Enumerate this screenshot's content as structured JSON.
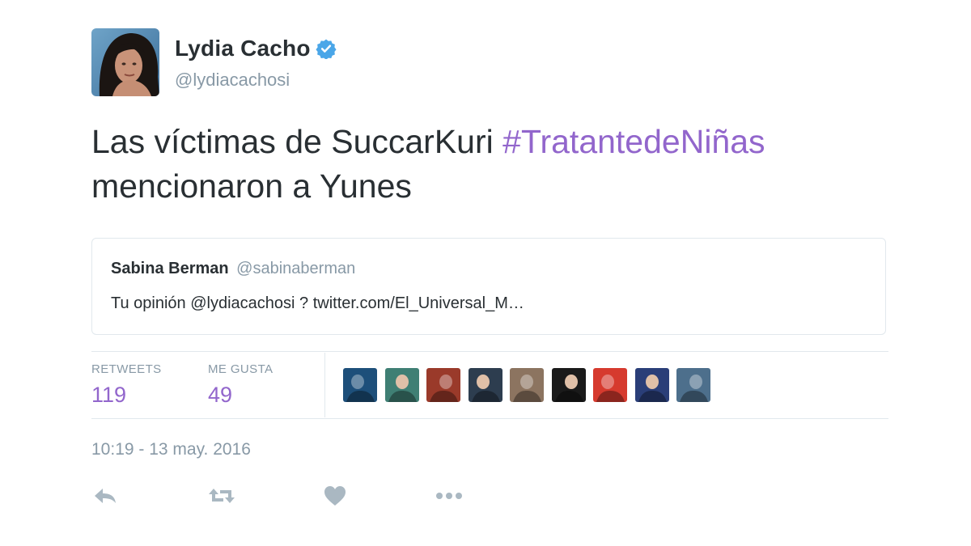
{
  "author": {
    "display_name": "Lydia Cacho",
    "handle": "@lydiacachosi",
    "verified": true
  },
  "tweet": {
    "text_plain": "Las víctimas de SuccarKuri ",
    "hashtag": "#TratantedeNiñas",
    "text_rest": "mencionaron a Yunes"
  },
  "quote": {
    "name": "Sabina Berman",
    "handle": "@sabinaberman",
    "text": "Tu opinión @lydiacachosi ? twitter.com/El_Universal_M…"
  },
  "stats": {
    "retweets_label": "RETWEETS",
    "retweets_value": "119",
    "likes_label": "ME GUSTA",
    "likes_value": "49"
  },
  "likers": [
    {
      "icon": "liker-avatar-1",
      "color": "#1d4f7a"
    },
    {
      "icon": "liker-avatar-2",
      "color": "#3f7f74"
    },
    {
      "icon": "liker-avatar-3",
      "color": "#9a3a2a"
    },
    {
      "icon": "liker-avatar-4",
      "color": "#2d3d4f"
    },
    {
      "icon": "liker-avatar-5",
      "color": "#8c7460"
    },
    {
      "icon": "liker-avatar-6",
      "color": "#1a1a1a"
    },
    {
      "icon": "liker-avatar-7",
      "color": "#d63a2e"
    },
    {
      "icon": "liker-avatar-8",
      "color": "#2a3e78"
    },
    {
      "icon": "liker-avatar-9",
      "color": "#4d6f8c"
    }
  ],
  "timestamp": "10:19 - 13 may. 2016",
  "actions": [
    {
      "name": "reply-icon"
    },
    {
      "name": "retweet-icon"
    },
    {
      "name": "heart-icon"
    },
    {
      "name": "more-icon"
    }
  ],
  "colors": {
    "hashtag": "#9266cc",
    "stat_value": "#9266cc",
    "muted": "#8899a6",
    "verified": "#4aa6e8",
    "action_icon": "#aab8c2"
  }
}
